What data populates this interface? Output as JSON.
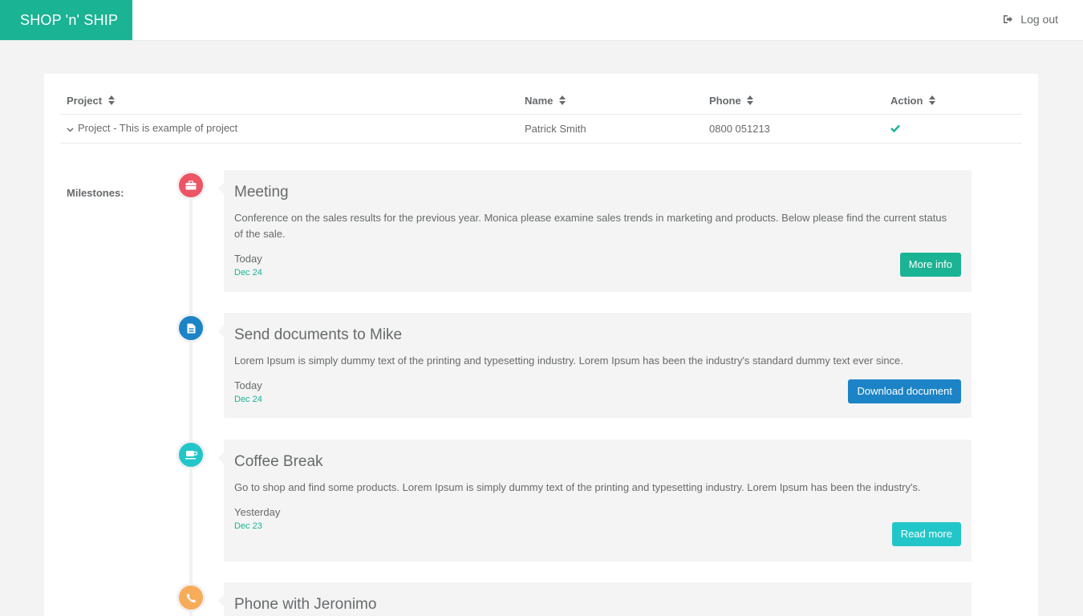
{
  "header": {
    "brand": "SHOP 'n' SHIP",
    "logout_label": "Log out"
  },
  "table": {
    "columns": [
      "Project",
      "Name",
      "Phone",
      "Action"
    ],
    "row": {
      "project": "Project - This is example of project",
      "name": "Patrick Smith",
      "phone": "0800 051213",
      "action_icon": "check-icon"
    }
  },
  "milestones": {
    "label": "Milestones:",
    "items": [
      {
        "icon": "briefcase-icon",
        "color": "#ed5565",
        "title": "Meeting",
        "text": "Conference on the sales results for the previous year. Monica please examine sales trends in marketing and products. Below please find the current status of the sale.",
        "when": "Today",
        "date": "Dec 24",
        "button": "More info",
        "button_color": "#1ab394"
      },
      {
        "icon": "file-text-icon",
        "color": "#1c84c6",
        "title": "Send documents to Mike",
        "text": "Lorem Ipsum is simply dummy text of the printing and typesetting industry. Lorem Ipsum has been the industry's standard dummy text ever since.",
        "when": "Today",
        "date": "Dec 24",
        "button": "Download document",
        "button_color": "#1c84c6"
      },
      {
        "icon": "coffee-icon",
        "color": "#23c6c8",
        "title": "Coffee Break",
        "text": "Go to shop and find some products. Lorem Ipsum is simply dummy text of the printing and typesetting industry. Lorem Ipsum has been the industry's.",
        "when": "Yesterday",
        "date": "Dec 23",
        "button": "Read more",
        "button_color": "#23c6c8"
      },
      {
        "icon": "phone-icon",
        "color": "#f8ac59",
        "title": "Phone with Jeronimo"
      }
    ]
  },
  "colors": {
    "brand": "#1ab394",
    "background": "#f3f3f4",
    "text": "#676a6c"
  }
}
